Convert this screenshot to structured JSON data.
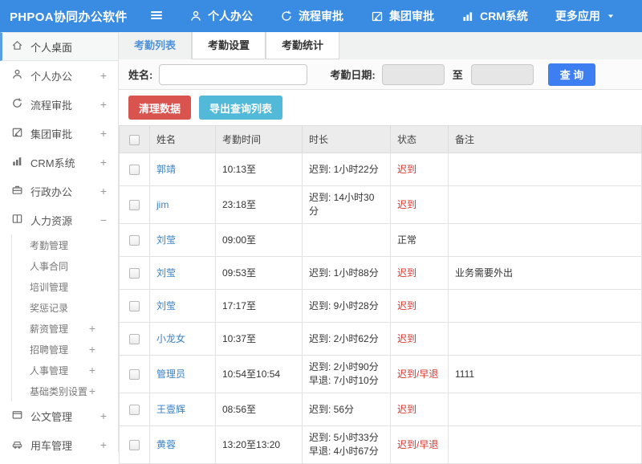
{
  "header": {
    "title": "PHPOA协同办公软件",
    "nav": [
      {
        "key": "personal-office",
        "label": "个人办公",
        "icon": "person-icon"
      },
      {
        "key": "workflow-approval",
        "label": "流程审批",
        "icon": "workflow-icon"
      },
      {
        "key": "group-approval",
        "label": "集团审批",
        "icon": "edit-icon"
      },
      {
        "key": "crm-system",
        "label": "CRM系统",
        "icon": "chart-icon"
      },
      {
        "key": "more-apps",
        "label": "更多应用",
        "icon": "caret-down-icon",
        "caret": true
      }
    ]
  },
  "sidebar": {
    "items": [
      {
        "key": "personal-desktop",
        "label": "个人桌面",
        "icon": "home-icon",
        "active": true
      },
      {
        "key": "personal-office",
        "label": "个人办公",
        "icon": "person-icon",
        "expander": "+"
      },
      {
        "key": "workflow-approval",
        "label": "流程审批",
        "icon": "workflow-icon",
        "expander": "+"
      },
      {
        "key": "group-approval",
        "label": "集团审批",
        "icon": "edit-icon",
        "expander": "+"
      },
      {
        "key": "crm-system",
        "label": "CRM系统",
        "icon": "chart-icon",
        "expander": "+"
      },
      {
        "key": "admin-office",
        "label": "行政办公",
        "icon": "briefcase-icon",
        "expander": "+"
      },
      {
        "key": "human-resources",
        "label": "人力资源",
        "icon": "book-icon",
        "expander": "−",
        "children": [
          {
            "key": "attendance-management",
            "label": "考勤管理"
          },
          {
            "key": "personnel-contract",
            "label": "人事合同"
          },
          {
            "key": "training-management",
            "label": "培训管理"
          },
          {
            "key": "reward-punishment",
            "label": "奖惩记录"
          },
          {
            "key": "salary-management",
            "label": "薪资管理",
            "expander": "+"
          },
          {
            "key": "recruitment-management",
            "label": "招聘管理",
            "expander": "+"
          },
          {
            "key": "personnel-management",
            "label": "人事管理",
            "expander": "+"
          },
          {
            "key": "basic-category-settings",
            "label": "基础类别设置",
            "expander": "+"
          }
        ]
      },
      {
        "key": "document-management",
        "label": "公文管理",
        "icon": "doc-icon",
        "expander": "+"
      },
      {
        "key": "vehicle-management",
        "label": "用车管理",
        "icon": "car-icon",
        "expander": "+"
      }
    ]
  },
  "tabs": [
    {
      "key": "attendance-list",
      "label": "考勤列表",
      "active": true
    },
    {
      "key": "attendance-settings",
      "label": "考勤设置"
    },
    {
      "key": "attendance-statistics",
      "label": "考勤统计"
    }
  ],
  "filter": {
    "name_label": "姓名:",
    "date_label": "考勤日期:",
    "to_label": "至",
    "search_button": "查 询"
  },
  "actions": {
    "clean_button": "清理数据",
    "export_button": "导出查询列表"
  },
  "table": {
    "columns": [
      "姓名",
      "考勤时间",
      "时长",
      "状态",
      "备注"
    ],
    "rows": [
      {
        "name": "郭靖",
        "time": "10:13至",
        "duration": [
          "迟到: 1小时22分"
        ],
        "status": "迟到",
        "status_type": "late",
        "note": ""
      },
      {
        "name": "jim",
        "time": "23:18至",
        "duration": [
          "迟到: 14小时30分"
        ],
        "status": "迟到",
        "status_type": "late",
        "note": ""
      },
      {
        "name": "刘莹",
        "time": "09:00至",
        "duration": [],
        "status": "正常",
        "status_type": "normal",
        "note": ""
      },
      {
        "name": "刘莹",
        "time": "09:53至",
        "duration": [
          "迟到: 1小时88分"
        ],
        "status": "迟到",
        "status_type": "late",
        "note": "业务需要外出"
      },
      {
        "name": "刘莹",
        "time": "17:17至",
        "duration": [
          "迟到: 9小时28分"
        ],
        "status": "迟到",
        "status_type": "late",
        "note": ""
      },
      {
        "name": "小龙女",
        "time": "10:37至",
        "duration": [
          "迟到: 2小时62分"
        ],
        "status": "迟到",
        "status_type": "late",
        "note": ""
      },
      {
        "name": "管理员",
        "time": "10:54至10:54",
        "duration": [
          "迟到: 2小时90分",
          "早退: 7小时10分"
        ],
        "status": "迟到/早退",
        "status_type": "late",
        "note": "1111"
      },
      {
        "name": "王壹辉",
        "time": "08:56至",
        "duration": [
          "迟到: 56分"
        ],
        "status": "迟到",
        "status_type": "late",
        "note": ""
      },
      {
        "name": "黄蓉",
        "time": "13:20至13:20",
        "duration": [
          "迟到: 5小时33分",
          "早退: 4小时67分"
        ],
        "status": "迟到/早退",
        "status_type": "late",
        "note": ""
      }
    ]
  },
  "colors": {
    "topbar": "#3a8ce2",
    "active_tab_text": "#4e93d9",
    "name_link": "#3b82c4",
    "late_status": "#d9342c",
    "clean_button_bg": "#d9534f",
    "export_button_bg": "#52b9d8",
    "search_button_bg": "#3d7ef0"
  }
}
